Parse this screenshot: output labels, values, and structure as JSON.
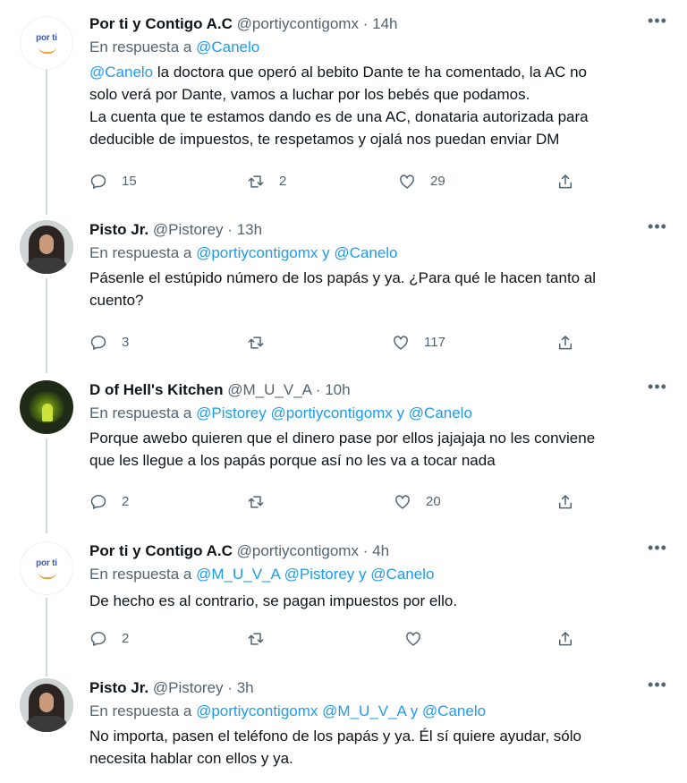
{
  "reply_prefix": "En respuesta a",
  "tweets": [
    {
      "name": "Por ti y Contigo A.C",
      "handle": "@portiycontigomx",
      "time": "14h",
      "avatar": "por-ti-logo",
      "avatar_text": "por ti",
      "reply_mentions": [
        "@Canelo"
      ],
      "reply_connector": "",
      "text_mention": "@Canelo",
      "text_lines": [
        " la doctora que operó al bebito Dante te ha comentado, la AC no",
        "solo verá por Dante, vamos a luchar por los bebés que podamos.",
        "La cuenta que te estamos dando es de una AC, donataria autorizada para",
        "deducible de impuestos, te respetamos y ojalá nos puedan enviar DM"
      ],
      "replies": "15",
      "retweets": "2",
      "likes": "29"
    },
    {
      "name": "Pisto Jr.",
      "handle": "@Pistorey",
      "time": "13h",
      "avatar": "pisto-photo",
      "reply_mentions": [
        "@portiycontigomx",
        "@Canelo"
      ],
      "reply_connector": "y",
      "text_lines": [
        "Pásenle el estúpido número de los papás y ya. ¿Para qué le hacen tanto al",
        "cuento?"
      ],
      "replies": "3",
      "retweets": "",
      "likes": "117"
    },
    {
      "name": "D of Hell's Kitchen",
      "handle": "@M_U_V_A",
      "time": "10h",
      "avatar": "hell-photo",
      "reply_mentions": [
        "@Pistorey",
        "@portiycontigomx",
        "@Canelo"
      ],
      "reply_connector": "y",
      "text_lines": [
        "Porque awebo quieren que el dinero pase por ellos jajajaja no les conviene",
        "que les llegue a los papás porque así no les va a tocar nada"
      ],
      "replies": "2",
      "retweets": "",
      "likes": "20"
    },
    {
      "name": "Por ti y Contigo A.C",
      "handle": "@portiycontigomx",
      "time": "4h",
      "avatar": "por-ti-logo",
      "avatar_text": "por ti",
      "reply_mentions": [
        "@M_U_V_A",
        "@Pistorey",
        "@Canelo"
      ],
      "reply_connector": "y",
      "text_lines": [
        "De hecho es al contrario, se pagan impuestos por ello."
      ],
      "replies": "2",
      "retweets": "",
      "likes": ""
    },
    {
      "name": "Pisto Jr.",
      "handle": "@Pistorey",
      "time": "3h",
      "avatar": "pisto-photo",
      "reply_mentions": [
        "@portiycontigomx",
        "@M_U_V_A",
        "@Canelo"
      ],
      "reply_connector": "y",
      "text_lines": [
        "No importa, pasen el teléfono de los papás y ya. Él sí quiere ayudar, sólo",
        "necesita hablar con ellos y ya."
      ]
    }
  ],
  "colors": {
    "accent": "#1d9bf0",
    "secondary_text": "#536471",
    "thread_line": "#cfd9de"
  },
  "icons": {
    "more": "more-horizontal-icon",
    "reply": "reply-bubble-icon",
    "retweet": "retweet-icon",
    "like": "heart-icon",
    "share": "share-icon"
  }
}
